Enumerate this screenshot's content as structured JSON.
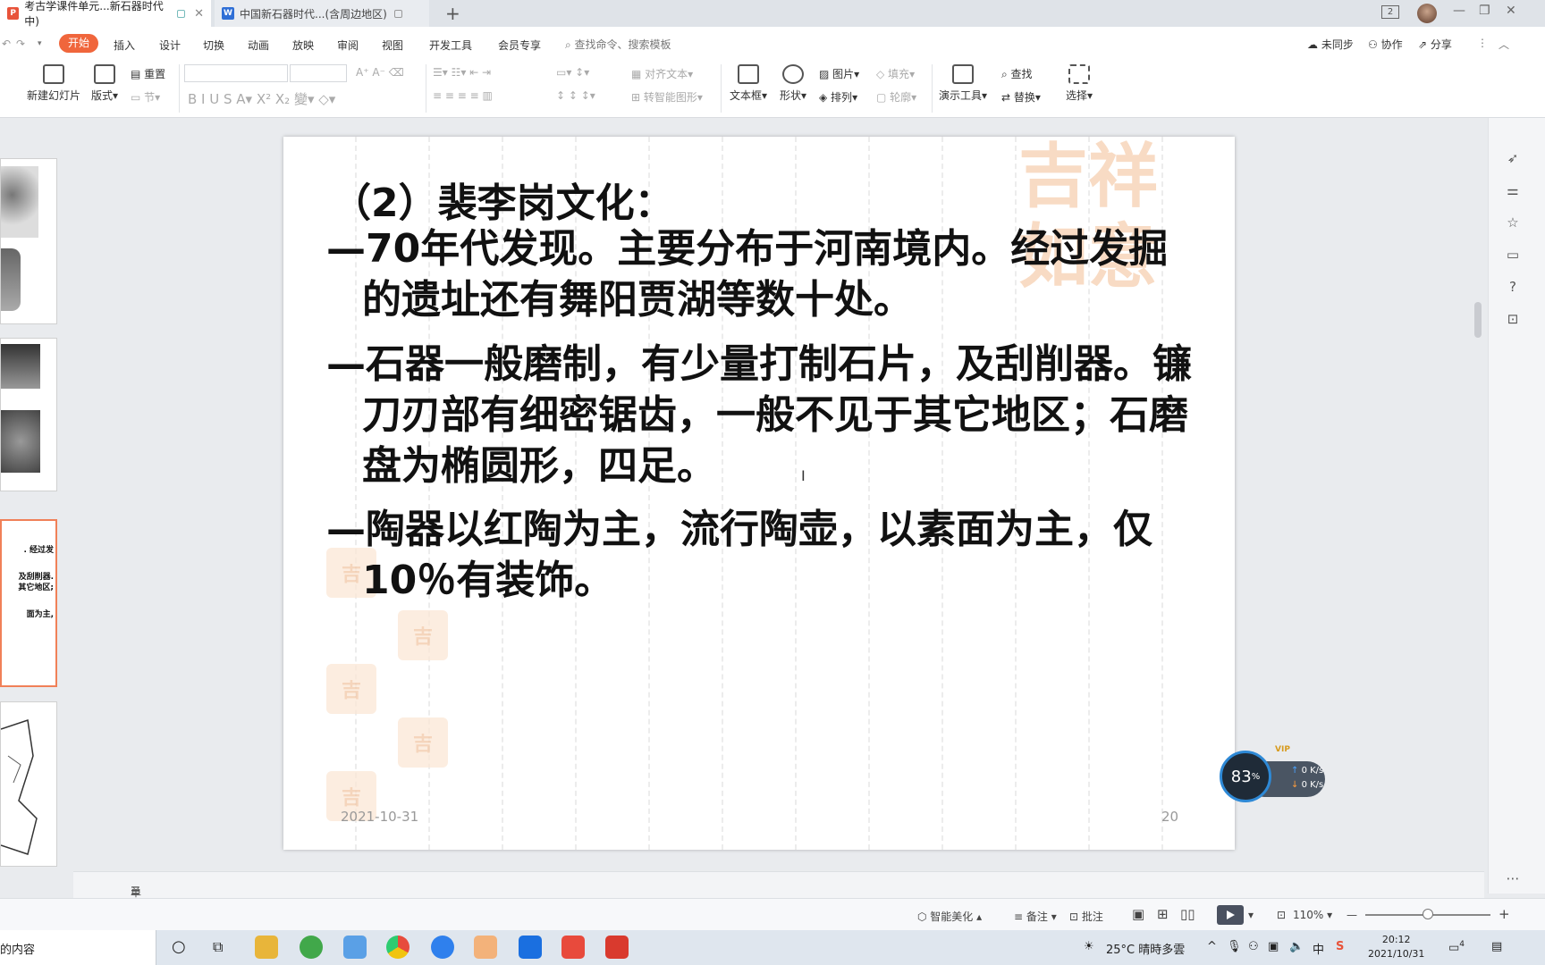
{
  "tabs": [
    {
      "label": "考古学课件单元...新石器时代中)",
      "icon": "wps-presentation-icon",
      "icon_color": "#e8533a",
      "active": true
    },
    {
      "label": "中国新石器时代...(含周边地区)",
      "icon": "wps-writer-icon",
      "icon_color": "#2f6fd6",
      "active": false
    }
  ],
  "window": {
    "badge_count": "2"
  },
  "menu": {
    "start": "开始",
    "items": [
      "插入",
      "设计",
      "切换",
      "动画",
      "放映",
      "审阅",
      "视图",
      "开发工具",
      "会员专享"
    ],
    "search_placeholder": "查找命令、搜索模板",
    "sync": "未同步",
    "collab": "协作",
    "share": "分享"
  },
  "ribbon": {
    "new_slide": "新建幻灯片",
    "layout": "版式",
    "reset": "重置",
    "section": "节",
    "align_text": "对齐文本",
    "smart_shape": "转智能图形",
    "textbox": "文本框",
    "shape": "形状",
    "picture": "图片",
    "arrange": "排列",
    "fill": "填充",
    "outline": "轮廓",
    "present_tools": "演示工具",
    "find": "查找",
    "replace": "替换",
    "select": "选择"
  },
  "slide": {
    "title": "（2）裴李岗文化：",
    "bullets": [
      "—70年代发现。主要分布于河南境内。经过发掘的遗址还有舞阳贾湖等数十处。",
      "—石器一般磨制，有少量打制石片，及刮削器。镰刀刃部有细密锯齿，一般不见于其它地区；石磨盘为椭圆形，四足。",
      "—陶器以红陶为主，流行陶壶，以素面为主，仅10％有装饰。"
    ],
    "date": "2021-10-31",
    "page_number": "20",
    "watermark": "吉祥如意"
  },
  "thumbnails": {
    "selected_lines": [
      ". 经过发",
      "及刮削器.",
      "其它地区;",
      "面为主,"
    ]
  },
  "notes_placeholder": "单击此处添加备注",
  "statusbar": {
    "beautify": "智能美化",
    "notes": "备注",
    "comments": "批注",
    "zoom": "110%"
  },
  "netmeter": {
    "percent": "83",
    "up": "0 K/s",
    "down": "0 K/s",
    "vip": "VIP"
  },
  "taskbar": {
    "search_text": "的内容",
    "weather": "25°C  晴時多雲",
    "ime": "中",
    "time": "20:12",
    "date": "2021/10/31",
    "notifications": "4"
  }
}
